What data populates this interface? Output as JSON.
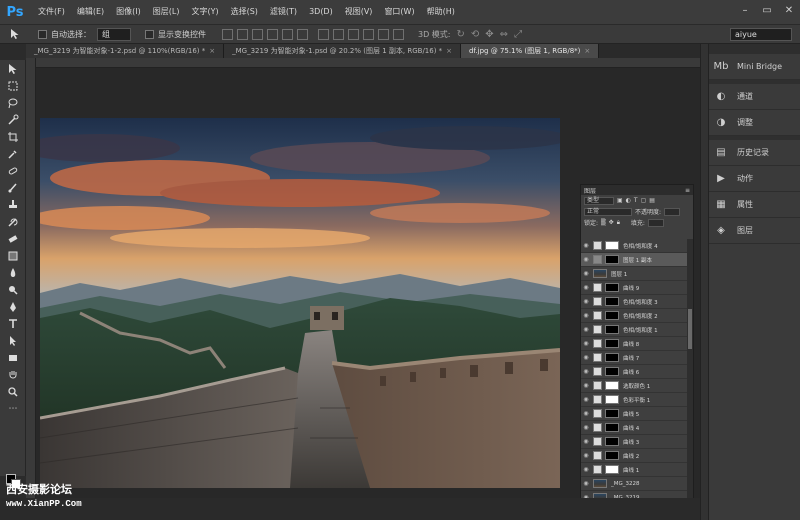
{
  "app": {
    "logo": "Ps"
  },
  "menu": [
    "文件(F)",
    "编辑(E)",
    "图像(I)",
    "图层(L)",
    "文字(Y)",
    "选择(S)",
    "滤镜(T)",
    "3D(D)",
    "视图(V)",
    "窗口(W)",
    "帮助(H)"
  ],
  "window_controls": {
    "minimize": "–",
    "restore": "▭",
    "close": "✕"
  },
  "options": {
    "auto_select_label": "自动选择：",
    "auto_select_value": "组",
    "show_transform_label": "显示变换控件",
    "mode_3d_label": "3D 模式:",
    "workspace": "aiyue"
  },
  "tabs": [
    {
      "label": "_MG_3219 为智能对象-1-2.psd @ 110%(RGB/16) *",
      "active": false
    },
    {
      "label": "_MG_3219 为智能对象-1.psd @ 20.2% (图层 1 副本, RGB/16) *",
      "active": false
    },
    {
      "label": "df.jpg @ 75.1% (图层 1, RGB/8*)",
      "active": true
    }
  ],
  "dock": [
    {
      "icon": "mini-bridge-icon",
      "glyph": "Mb",
      "label": "Mini Bridge"
    },
    {
      "icon": "channels-icon",
      "glyph": "◐",
      "label": "通道"
    },
    {
      "icon": "adjustments-icon",
      "glyph": "◑",
      "label": "调整"
    },
    {
      "icon": "history-icon",
      "glyph": "▤",
      "label": "历史记录"
    },
    {
      "icon": "actions-icon",
      "glyph": "▶",
      "label": "动作"
    },
    {
      "icon": "properties-icon",
      "glyph": "▦",
      "label": "属性"
    },
    {
      "icon": "layers-icon",
      "glyph": "◈",
      "label": "图层"
    }
  ],
  "layers_panel": {
    "title": "图层",
    "filter_label": "类型",
    "blend_mode": "正常",
    "opacity_label": "不透明度:",
    "lock_label": "锁定:",
    "fill_label": "填充:",
    "layers": [
      {
        "name": "色相/饱和度 4",
        "thumb": "white",
        "selected": false
      },
      {
        "name": "图层 1 副本",
        "thumb": "black",
        "selected": true
      },
      {
        "name": "图层 1",
        "thumb": "photo",
        "selected": false
      },
      {
        "name": "曲线 9",
        "thumb": "black",
        "selected": false
      },
      {
        "name": "色相/饱和度 3",
        "thumb": "black",
        "selected": false
      },
      {
        "name": "色相/饱和度 2",
        "thumb": "black",
        "selected": false
      },
      {
        "name": "色相/饱和度 1",
        "thumb": "black",
        "selected": false
      },
      {
        "name": "曲线 8",
        "thumb": "black",
        "selected": false
      },
      {
        "name": "曲线 7",
        "thumb": "black",
        "selected": false
      },
      {
        "name": "曲线 6",
        "thumb": "black",
        "selected": false
      },
      {
        "name": "选取颜色 1",
        "thumb": "white",
        "selected": false
      },
      {
        "name": "色彩平衡 1",
        "thumb": "white",
        "selected": false
      },
      {
        "name": "曲线 5",
        "thumb": "black",
        "selected": false
      },
      {
        "name": "曲线 4",
        "thumb": "black",
        "selected": false
      },
      {
        "name": "曲线 3",
        "thumb": "black",
        "selected": false
      },
      {
        "name": "曲线 2",
        "thumb": "black",
        "selected": false
      },
      {
        "name": "曲线 1",
        "thumb": "black",
        "selected": false
      },
      {
        "name": "_MG_3228",
        "thumb": "photo",
        "selected": false
      },
      {
        "name": "_MG_3219",
        "thumb": "photo",
        "selected": false
      }
    ]
  },
  "watermark": {
    "title": "西安摄影论坛",
    "url": "www.XianPP.Com"
  },
  "colors": {
    "accent": "#33a6ff",
    "ui_bg": "#2b2b2b",
    "panel_bg": "#3a3a3a"
  }
}
